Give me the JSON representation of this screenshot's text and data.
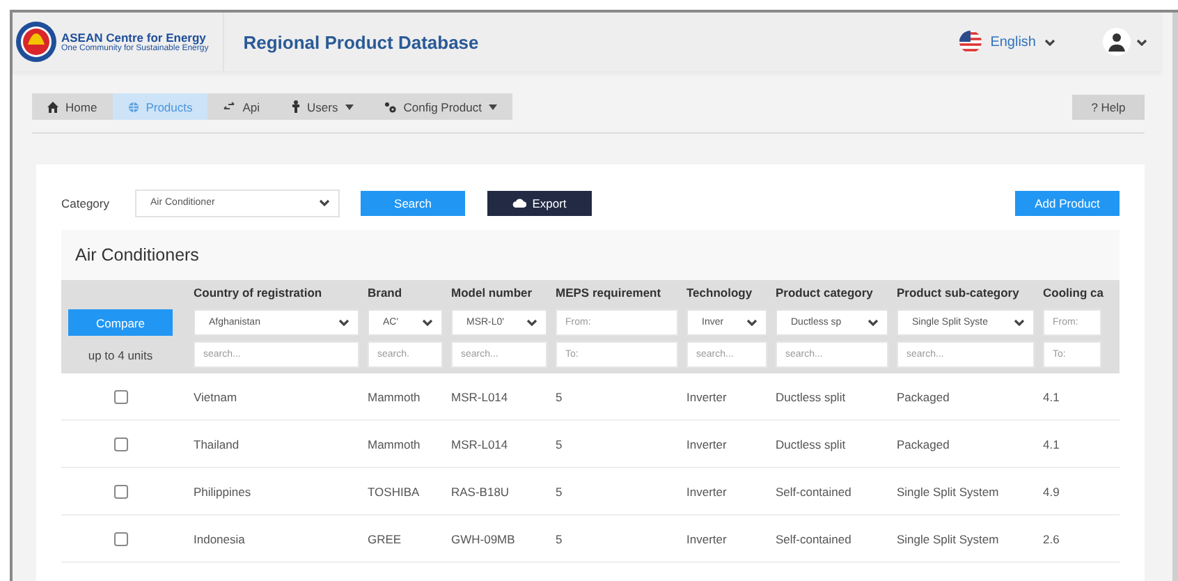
{
  "header": {
    "org_name": "ASEAN Centre for Energy",
    "org_tagline": "One Community for Sustainable Energy",
    "title": "Regional Product Database",
    "language": "English"
  },
  "nav": [
    {
      "label": "Home",
      "selected": false,
      "dropdown": false
    },
    {
      "label": "Products",
      "selected": true,
      "dropdown": false
    },
    {
      "label": "Api",
      "selected": false,
      "dropdown": false
    },
    {
      "label": "Users",
      "selected": false,
      "dropdown": true
    },
    {
      "label": "Config Product",
      "selected": false,
      "dropdown": true
    }
  ],
  "help_button": "? Help",
  "toolbar": {
    "category_label": "Category",
    "category_value": "Air Conditioner",
    "search_button": "Search",
    "export_button": "Export",
    "add_button": "Add Product"
  },
  "table": {
    "title": "Air Conditioners",
    "compare_button": "Compare",
    "compare_note": "up to 4 units",
    "columns": [
      {
        "header": "Country of registration",
        "kind": "select",
        "value": "Afghanistan",
        "placeholder": "search..."
      },
      {
        "header": "Brand",
        "kind": "select",
        "value": "AC'",
        "placeholder": "search."
      },
      {
        "header": "Model number",
        "kind": "select",
        "value": "MSR-L0'",
        "placeholder": "search..."
      },
      {
        "header": "MEPS requirement",
        "kind": "range",
        "from_placeholder": "From:",
        "to_placeholder": "To:"
      },
      {
        "header": "Technology",
        "kind": "select",
        "value": "Inver",
        "placeholder": "search..."
      },
      {
        "header": "Product category",
        "kind": "select",
        "value": "Ductless sp",
        "placeholder": "search..."
      },
      {
        "header": "Product sub-category",
        "kind": "select",
        "value": "Single Split Syste",
        "placeholder": "search..."
      },
      {
        "header": "Cooling ca",
        "kind": "range",
        "from_placeholder": "From:",
        "to_placeholder": "To:"
      }
    ],
    "rows": [
      {
        "checked": false,
        "cells": [
          "Vietnam",
          "Mammoth",
          "MSR-L014",
          "5",
          "Inverter",
          "Ductless split",
          "Packaged",
          "4.1"
        ]
      },
      {
        "checked": false,
        "cells": [
          "Thailand",
          "Mammoth",
          "MSR-L014",
          "5",
          "Inverter",
          "Ductless split",
          "Packaged",
          "4.1"
        ]
      },
      {
        "checked": false,
        "cells": [
          "Philippines",
          "TOSHIBA",
          "RAS-B18U",
          "5",
          "Inverter",
          "Self-contained",
          "Single Split System",
          "4.9"
        ]
      },
      {
        "checked": false,
        "cells": [
          "Indonesia",
          "GREE",
          "GWH-09MB",
          "5",
          "Inverter",
          "Self-contained",
          "Single Split System",
          "2.6"
        ]
      }
    ]
  }
}
